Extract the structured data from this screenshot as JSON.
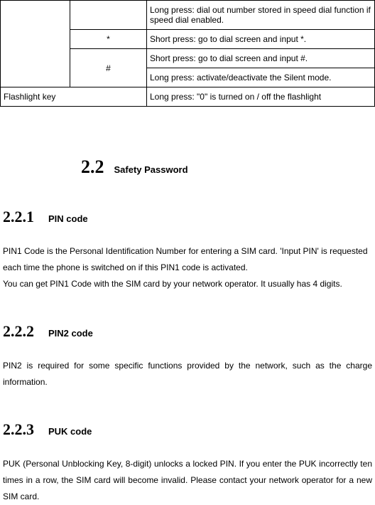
{
  "table": {
    "row1_desc": "Long press: dial out number stored in speed dial function if speed dial enabled.",
    "row2_key": "*",
    "row2_desc": "Short press: go to dial screen and input *.",
    "row3_key": "#",
    "row3_desc": "Short press: go to dial screen and input #.",
    "row4_desc": "Long press: activate/deactivate the Silent mode.",
    "row5_col1": "Flashlight key",
    "row5_desc": "Long press: \"0\" is turned on / off the flashlight"
  },
  "section22": {
    "num": "2.2",
    "title": "Safety Password"
  },
  "s221": {
    "num": "2.2.1",
    "title": "PIN code",
    "para": "PIN1 Code is the Personal Identification Number for entering a SIM card. 'Input PIN' is requested each time the phone is switched on if this PIN1 code is activated.\nYou can get PIN1 Code with the SIM card by your network operator. It usually has 4 digits."
  },
  "s222": {
    "num": "2.2.2",
    "title": "PIN2 code",
    "para": "PIN2 is required for some specific functions provided by the network, such as the charge information."
  },
  "s223": {
    "num": "2.2.3",
    "title": "PUK code",
    "para": "PUK (Personal Unblocking Key, 8-digit) unlocks a locked PIN. If you enter the PUK incorrectly ten times in a row, the SIM card will become invalid. Please contact your network operator for a new SIM card."
  }
}
